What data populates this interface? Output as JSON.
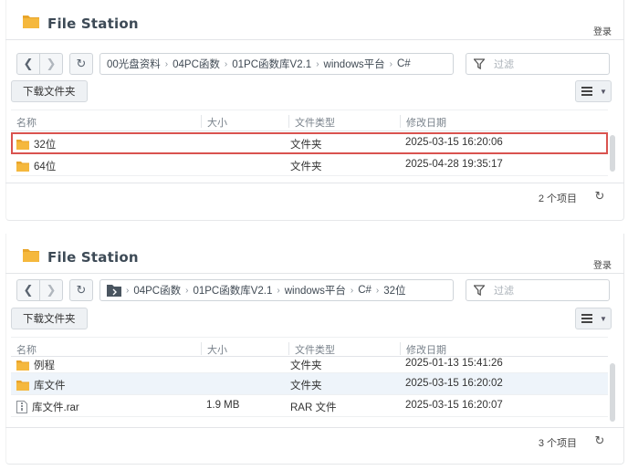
{
  "windows": [
    {
      "title": "File Station",
      "login_label": "登录",
      "path": [
        "00光盘资料",
        "04PC函数",
        "01PC函数库V2.1",
        "windows平台",
        "C#"
      ],
      "filter_placeholder": "过滤",
      "download_label": "下载文件夹",
      "columns": [
        "名称",
        "大小",
        "文件类型",
        "修改日期"
      ],
      "rows": [
        {
          "name": "32位",
          "size": "",
          "type": "文件夹",
          "modified": "2025-03-15 16:20:06",
          "icon": "folder-icon"
        },
        {
          "name": "64位",
          "size": "",
          "type": "文件夹",
          "modified": "2025-04-28 19:35:17",
          "icon": "folder-icon"
        }
      ],
      "item_count": "2 个项目",
      "highlight_color": "#d9534f"
    },
    {
      "title": "File Station",
      "login_label": "登录",
      "path": [
        "04PC函数",
        "01PC函数库V2.1",
        "windows平台",
        "C#",
        "32位"
      ],
      "filter_placeholder": "过滤",
      "download_label": "下载文件夹",
      "columns": [
        "名称",
        "大小",
        "文件类型",
        "修改日期"
      ],
      "rows": [
        {
          "name": "例程",
          "size": "",
          "type": "文件夹",
          "modified": "2025-01-13 15:41:26",
          "icon": "folder-icon"
        },
        {
          "name": "库文件",
          "size": "",
          "type": "文件夹",
          "modified": "2025-03-15 16:20:02",
          "icon": "folder-icon"
        },
        {
          "name": "库文件.rar",
          "size": "1.9 MB",
          "type": "RAR 文件",
          "modified": "2025-03-15 16:20:07",
          "icon": "archive-icon"
        }
      ],
      "item_count": "3 个项目"
    }
  ],
  "colors": {
    "folder": "#f5b83d",
    "folder_tab": "#e9a52a",
    "hover_row": "#eef4fa"
  }
}
